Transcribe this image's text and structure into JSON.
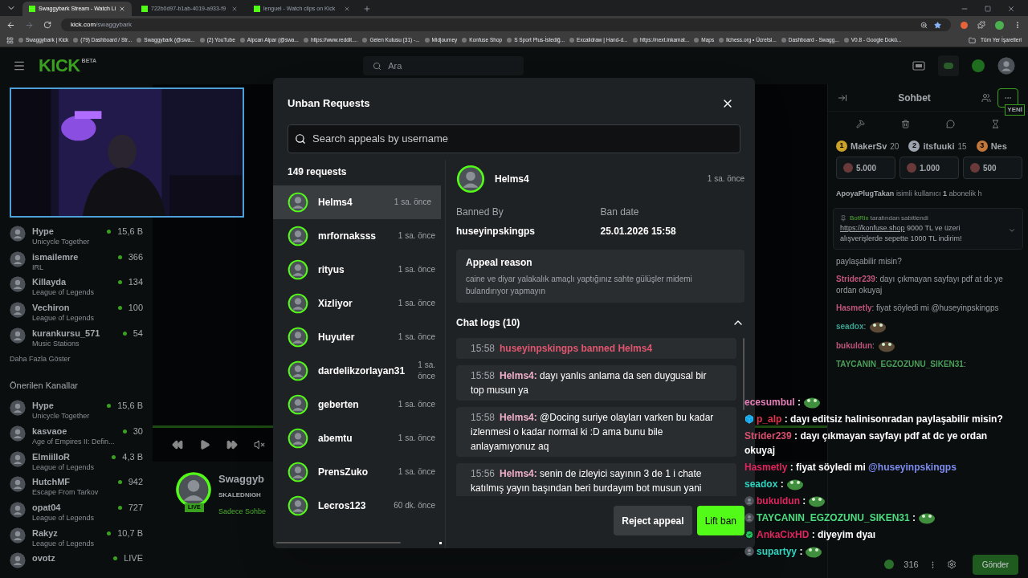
{
  "browser": {
    "tabs": [
      {
        "title": "Swaggybark Stream - Watch Li",
        "selected": true
      },
      {
        "title": "722b0d97-b1ab-4019-a933-f9",
        "selected": false
      },
      {
        "title": "lenguel - Watch clips on Kick",
        "selected": false
      }
    ],
    "host": "kick.com",
    "path": "/swaggybark",
    "bookmarks": [
      "Swaggybark | Kick",
      "(79) Dashboard / Str...",
      "Swaggybark (@swa...",
      "(2) YouTube",
      "Alpcan Alpar (@swa...",
      "https://www.reddit....",
      "Gelen Kutusu (31) -...",
      "Midjourney",
      "Konfuse Shop",
      "S Sport Plus-İstediğ...",
      "Excalidraw | Hand-d...",
      "https://next.inkamat...",
      "Maps",
      "lichess.org • Ücretsi...",
      "Dashboard - Swagg...",
      "V0.8 - Google Dokü..."
    ],
    "all_bookmarks": "Tüm Yer İşaretleri"
  },
  "header": {
    "logo": "KICK",
    "logo_badge": "BETA",
    "search_placeholder": "Ara"
  },
  "sidebar": {
    "followed": [
      {
        "name": "Hype",
        "game": "Unicycle Together",
        "viewers": "15,6 B"
      },
      {
        "name": "ismailemre",
        "game": "IRL",
        "viewers": "366"
      },
      {
        "name": "Killayda",
        "game": "League of Legends",
        "viewers": "134"
      },
      {
        "name": "Vechiron",
        "game": "League of Legends",
        "viewers": "100"
      },
      {
        "name": "kurankursu_571",
        "game": "Music Stations",
        "viewers": "54"
      }
    ],
    "show_more": "Daha Fazla Göster",
    "recommended_title": "Önerilen Kanallar",
    "recommended": [
      {
        "name": "Hype",
        "game": "Unicycle Together",
        "viewers": "15,6 B"
      },
      {
        "name": "kasvaoe",
        "game": "Age of Empires II: Defin...",
        "viewers": "30"
      },
      {
        "name": "ElmiilloR",
        "game": "League of Legends",
        "viewers": "4,3 B"
      },
      {
        "name": "HutchMF",
        "game": "Escape From Tarkov",
        "viewers": "942"
      },
      {
        "name": "opat04",
        "game": "League of Legends",
        "viewers": "727"
      },
      {
        "name": "Rakyz",
        "game": "League of Legends",
        "viewers": "10,7 B"
      },
      {
        "name": "ovotz",
        "viewers": "LIVE"
      }
    ]
  },
  "player": {
    "channel": "Swaggyb",
    "title": "SKALEDNIGH",
    "category": "Sadece Sohbe",
    "live_badge": "LIVE"
  },
  "chat": {
    "title": "Sohbet",
    "new_badge": "YENİ",
    "leaders": [
      {
        "rank": "1",
        "name": "MakerSv",
        "score": "20",
        "color": "#c9a227"
      },
      {
        "rank": "2",
        "name": "itsfuuki",
        "score": "15",
        "color": "#9ca3af"
      },
      {
        "rank": "3",
        "name": "Nes",
        "color": "#c2773a"
      }
    ],
    "gifts": [
      "5.000",
      "1.000",
      "500"
    ],
    "sub_notice": {
      "user": "ApoyaPlugTakan",
      "text": "isimli kullanıcı",
      "count": "1",
      "rest": "abonelik h"
    },
    "pinned": {
      "by": "BotRix",
      "by_text": "tarafından sabitlendi",
      "link": "https://konfuse.shop",
      "text": "9000 TL ve üzeri alışverişlerde sepette 1000 TL indirim!"
    },
    "messages": [
      {
        "text": "paylaşabilir misin?"
      },
      {
        "user": "Strider239",
        "color": "#c0557b",
        "text": ": dayı çıkmayan sayfayı pdf at dc ye ordan okuyaj"
      },
      {
        "user": "Hasmetly",
        "color": "#c0557b",
        "text": ": fiyat söyledi mi @huseyinpskingps"
      },
      {
        "user": "seadox",
        "color": "#3aa08f",
        "text": ":",
        "emote": true
      },
      {
        "user": "bukuldun",
        "color": "#c0557b",
        "text": ":",
        "emote": true
      },
      {
        "user": "TAYCANIN_EGZOZUNU_SIKEN31",
        "color": "#4a9f5a",
        "text": ":"
      }
    ],
    "points": "316",
    "send": "Gönder"
  },
  "modal": {
    "title": "Unban Requests",
    "search_placeholder": "Search appeals by username",
    "count": "149 requests",
    "requests": [
      {
        "name": "Helms4",
        "time": "1 sa. önce",
        "selected": true
      },
      {
        "name": "mrfornaksss",
        "time": "1 sa. önce",
        "selected": false
      },
      {
        "name": "rityus",
        "time": "1 sa. önce",
        "selected": false
      },
      {
        "name": "Xizliyor",
        "time": "1 sa. önce",
        "selected": false
      },
      {
        "name": "Huyuter",
        "time": "1 sa. önce",
        "selected": false
      },
      {
        "name": "dardelikzorlayan31",
        "time": "1 sa. önce",
        "selected": false
      },
      {
        "name": "geberten",
        "time": "1 sa. önce",
        "selected": false
      },
      {
        "name": "abemtu",
        "time": "1 sa. önce",
        "selected": false
      },
      {
        "name": "PrensZuko",
        "time": "1 sa. önce",
        "selected": false
      },
      {
        "name": "Lecros123",
        "time": "60 dk. önce",
        "selected": false
      }
    ],
    "detail": {
      "name": "Helms4",
      "time": "1 sa. önce",
      "banned_by_label": "Banned By",
      "banned_by": "huseyinpskingps",
      "ban_date_label": "Ban date",
      "ban_date": "25.01.2026 15:58",
      "appeal_title": "Appeal reason",
      "appeal_text": "caine ve diyar yalakalık amaçlı yaptığınız sahte gülüşler midemi bulandırıyor yapmayın",
      "logs_title": "Chat logs (10)",
      "logs_expanded": true,
      "logs": [
        {
          "kind": "ban",
          "time": "15:58",
          "text": "huseyinpskingps banned Helms4"
        },
        {
          "kind": "message",
          "time": "15:58",
          "user": "Helms4:",
          "text": "dayı yanlıs anlama da sen duygusal bir top musun ya"
        },
        {
          "kind": "message",
          "time": "15:58",
          "user": "Helms4:",
          "text": "@Docing suriye olayları varken bu kadar izlenmesi o kadar normal ki :D ama bunu bile anlayamıyonuz aq"
        },
        {
          "kind": "message",
          "time": "15:56",
          "user": "Helms4:",
          "text": "senin de izleyici sayının 3 de 1 i chate katılmış yayın başından beri burdayım bot musun yani"
        }
      ]
    },
    "reject": "Reject appeal",
    "lift": "Lift ban"
  },
  "overlay_chat": [
    {
      "kind": "plain",
      "user": "ecesumbul",
      "color": "#e67fb9",
      "text": ":",
      "emote": true
    },
    {
      "kind": "cube",
      "user": "p_alp",
      "color": "#e5334f",
      "text": ": dayı editsiz halinisonradan paylaşabilir misin?"
    },
    {
      "kind": "plain",
      "user": "Strider239",
      "color": "#d9506f",
      "text": ": dayı çıkmayan sayfayı pdf at dc ye ordan okuyaj"
    },
    {
      "kind": "plain",
      "user": "Hasmetly",
      "color": "#e0245e",
      "text": ": fiyat söyledi mi",
      "mention": "@huseyinpskingps"
    },
    {
      "kind": "plain",
      "user": "seadox",
      "color": "#2dd4bf",
      "text": ":",
      "emote": true
    },
    {
      "kind": "avatar",
      "user": "bukuldun",
      "color": "#e0245e",
      "text": ":",
      "emote": true
    },
    {
      "kind": "avatar",
      "user": "TAYCANIN_EGZOZUNU_SIKEN31",
      "color": "#4ade80",
      "text": ":",
      "emote": true
    },
    {
      "kind": "check",
      "user": "AnkaCixHD",
      "color": "#e0245e",
      "text": ": diyeyim dyaı"
    },
    {
      "kind": "avatar",
      "user": "supartyy",
      "color": "#2dd4bf",
      "text": ":",
      "emote": true
    }
  ]
}
